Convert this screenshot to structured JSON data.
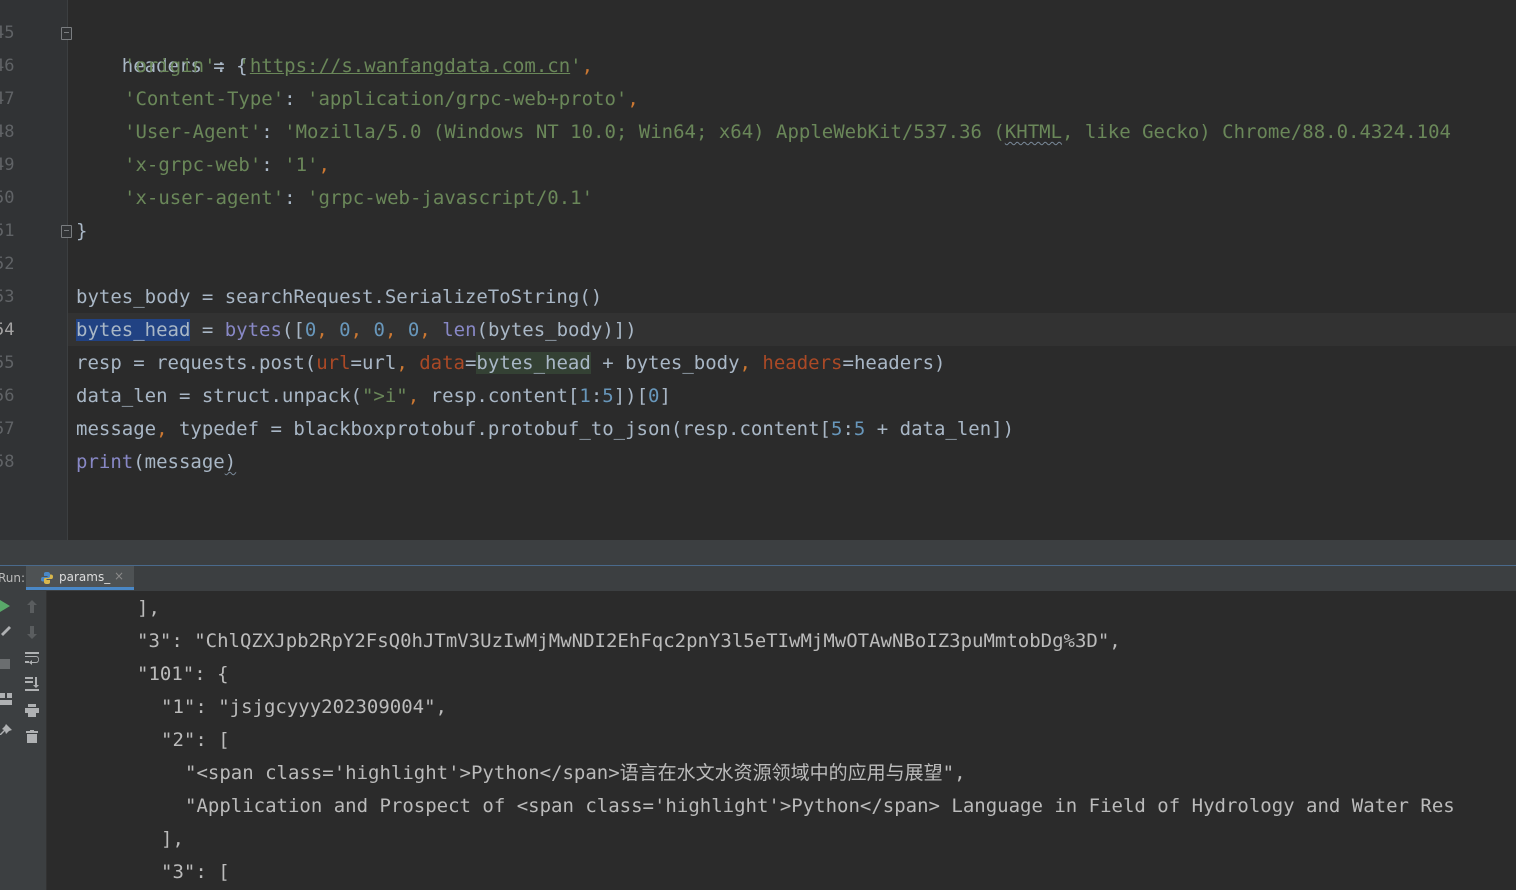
{
  "editor": {
    "line_numbers": [
      "45",
      "46",
      "47",
      "48",
      "49",
      "50",
      "51",
      "52",
      "53",
      "54",
      "55",
      "56",
      "57",
      "58"
    ],
    "lines": {
      "l45": {
        "a": "headers = {"
      },
      "l46": {
        "a": "'origin'",
        "b": ": ",
        "c": "'",
        "d": "https://s.wanfangdata.com.cn",
        "e": "'",
        "f": ","
      },
      "l47": {
        "a": "'Content-Type'",
        "b": ": ",
        "c": "'application/grpc-web+proto'",
        "d": ","
      },
      "l48": {
        "a": "'User-Agent'",
        "b": ": ",
        "c": "'Mozilla/5.0 (Windows NT 10.0; Win64; x64) AppleWebKit/537.36 (",
        "d": "KHTML",
        "e": ", like Gecko) Chrome/88.0.4324.104"
      },
      "l49": {
        "a": "'x-grpc-web'",
        "b": ": ",
        "c": "'1'",
        "d": ","
      },
      "l50": {
        "a": "'x-user-agent'",
        "b": ": ",
        "c": "'grpc-web-javascript/0.1'"
      },
      "l51": {
        "a": "}"
      },
      "l53": {
        "a": "bytes_body = searchRequest.SerializeToString()"
      },
      "l54": {
        "a": "bytes_head",
        "b": " = ",
        "c": "bytes",
        "d": "([",
        "e": "0",
        "f": ", ",
        "g": "0",
        "h": ", ",
        "i": "0",
        "j": ", ",
        "k": "0",
        "l": ", ",
        "m": "len",
        "n": "(bytes_body)])"
      },
      "l55": {
        "a": "resp = requests.post(",
        "b": "url",
        "c": "=url",
        "d": ", ",
        "e": "data",
        "f": "=",
        "g": "bytes_head",
        "h": " + bytes_body",
        "i": ", ",
        "j": "headers",
        "k": "=headers)"
      },
      "l56": {
        "a": "data_len = struct.unpack(",
        "b": "\">i\"",
        "c": ", ",
        "d": "resp.content[",
        "e": "1",
        "f": ":",
        "g": "5",
        "h": "])[",
        "i": "0",
        "j": "]"
      },
      "l57": {
        "a": "message",
        "b": ", ",
        "c": "typedef = blackboxprotobuf.protobuf_to_json(resp.content[",
        "d": "5",
        "e": ":",
        "f": "5",
        "g": " + data_len])"
      },
      "l58": {
        "a": "print",
        "b": "(message",
        "c": ")"
      }
    }
  },
  "run_panel": {
    "label": "Run:",
    "tab": {
      "name": "params_",
      "close": "×"
    },
    "toolbar_icons": [
      "run-icon",
      "wrench-icon",
      "stop-icon",
      "layout-icon",
      "pin-icon",
      "up-arrow-icon",
      "down-arrow-icon",
      "soft-wrap-icon",
      "scroll-to-end-icon",
      "print-icon",
      "trash-icon"
    ],
    "output": [
      "],",
      "\"3\": \"ChlQZXJpb2RpY2FsQ0hJTmV3UzIwMjMwNDI2EhFqc2pnY3l5eTIwMjMwOTAwNBoIZ3puMmtobDg%3D\",",
      "\"101\": {",
      "\"1\": \"jsjgcyyy202309004\",",
      "\"2\": [",
      "\"<span class='highlight'>Python</span>语言在水文水资源领域中的应用与展望\",",
      "\"Application and Prospect of <span class='highlight'>Python</span> Language in Field of Hydrology and Water Res",
      "],",
      "\"3\": ["
    ]
  },
  "colors": {
    "background": "#2b2b2b",
    "string": "#6a8759",
    "number": "#6897bb",
    "keyword": "#cc7832",
    "builtin": "#8888c6",
    "keyword_arg": "#aa4926",
    "selection": "#214283"
  }
}
